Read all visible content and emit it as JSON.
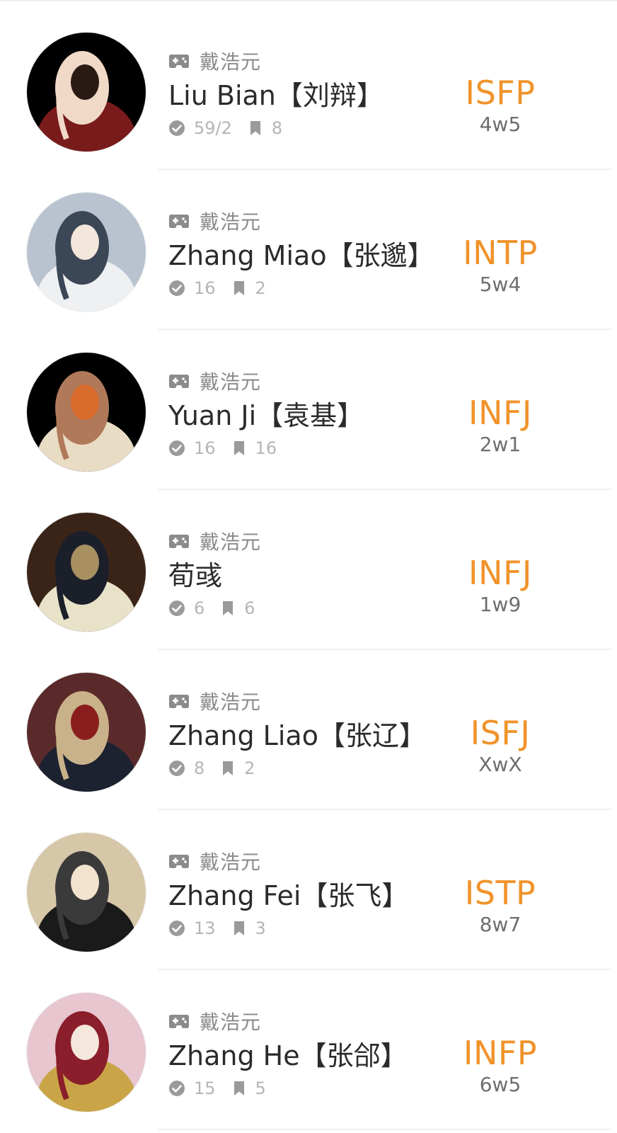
{
  "category_icon": "gamepad-icon",
  "colors": {
    "accent": "#f0932b",
    "name": "#2b2b2b",
    "meta": "#8b8b8b",
    "stat": "#b5b5b5",
    "enneagram": "#6e6e6e"
  },
  "profiles": [
    {
      "category": "戴浩元",
      "name": "Liu Bian【刘辩】",
      "votes": "59/2",
      "comments": "8",
      "mbti": "ISFP",
      "enneagram": "4w5",
      "avatar_palette": [
        "#000000",
        "#7a1b1b",
        "#f1d9c8",
        "#2a1a14"
      ]
    },
    {
      "category": "戴浩元",
      "name": "Zhang Miao【张邈】",
      "votes": "16",
      "comments": "2",
      "mbti": "INTP",
      "enneagram": "5w4",
      "avatar_palette": [
        "#b8c3cf",
        "#eef0f2",
        "#3b4656",
        "#f3e6da"
      ]
    },
    {
      "category": "戴浩元",
      "name": "Yuan Ji【袁基】",
      "votes": "16",
      "comments": "16",
      "mbti": "INFJ",
      "enneagram": "2w1",
      "avatar_palette": [
        "#000000",
        "#e9dcc4",
        "#b07a5a",
        "#d96b2d"
      ]
    },
    {
      "category": "戴浩元",
      "name": "荀彧",
      "votes": "6",
      "comments": "6",
      "mbti": "INFJ",
      "enneagram": "1w9",
      "avatar_palette": [
        "#3a2418",
        "#e8e2c8",
        "#1b1f2a",
        "#a89060"
      ]
    },
    {
      "category": "戴浩元",
      "name": "Zhang Liao【张辽】",
      "votes": "8",
      "comments": "2",
      "mbti": "ISFJ",
      "enneagram": "XwX",
      "avatar_palette": [
        "#5a2a2a",
        "#1c2230",
        "#c9b28a",
        "#8a1e1e"
      ]
    },
    {
      "category": "戴浩元",
      "name": "Zhang Fei【张飞】",
      "votes": "13",
      "comments": "3",
      "mbti": "ISTP",
      "enneagram": "8w7",
      "avatar_palette": [
        "#d6c7a8",
        "#1a1a1a",
        "#3a3a3a",
        "#f2e3cf"
      ]
    },
    {
      "category": "戴浩元",
      "name": "Zhang He【张郃】",
      "votes": "15",
      "comments": "5",
      "mbti": "INFP",
      "enneagram": "6w5",
      "avatar_palette": [
        "#e7c6cf",
        "#c9a548",
        "#8a1e2a",
        "#f4e7dc"
      ]
    }
  ]
}
